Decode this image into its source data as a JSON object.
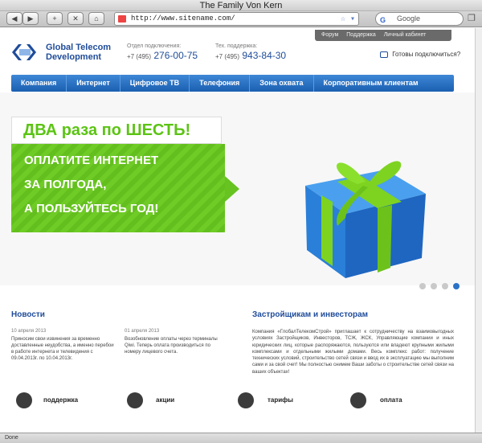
{
  "window": {
    "title": "The Family Von Kern"
  },
  "toolbar": {
    "url": "http://www.sitename.com/",
    "search_placeholder": "Google",
    "search_engine": "G"
  },
  "header": {
    "brand_line1": "Global Telecom",
    "brand_line2": "Development",
    "contacts": [
      {
        "label": "Отдел подключения:",
        "prefix": "+7 (495)",
        "number": "276-00-75"
      },
      {
        "label": "Тех. поддержка:",
        "prefix": "+7 (495)",
        "number": "943-84-30"
      }
    ],
    "top_links": [
      "Форум",
      "Поддержка",
      "Личный кабинет"
    ],
    "ready_text": "Готовы подключиться?"
  },
  "menu": [
    "Компания",
    "Интернет",
    "Цифровое ТВ",
    "Телефония",
    "Зона охвата",
    "Корпоративным клиентам"
  ],
  "banner": {
    "headline": "ДВА раза по ШЕСТЬ!",
    "lines": [
      "ОПЛАТИТЕ ИНТЕРНЕТ",
      "ЗА ПОЛГОДА,",
      "А ПОЛЬЗУЙТЕСЬ ГОД!"
    ]
  },
  "slider": {
    "total": 4,
    "active": 4
  },
  "news": {
    "title": "Новости",
    "items": [
      {
        "date": "10 апреля 2013",
        "text": "Приносим свои извинения за временно доставленные неудобства, а именно перебои в работе интернета и телевидения с 09.04.2013г. по 10.04.2013г."
      },
      {
        "date": "01 апреля 2013",
        "text": "Возобновление оплаты через терминалы Qiwi. Теперь оплата производиться по номеру лицевого счета."
      }
    ]
  },
  "investors": {
    "title": "Застройщикам и инвесторам",
    "text": "Компания «ГлобалТелекомСтрой» приглашает к сотрудничеству на взаимовыгодных условиях Застройщиков, Инвесторов, ТСЖ, ЖСК, Управляющие компании и иных юридических лиц, которые распоряжаются, пользуются или владеют крупными жилыми комплексами и отдельными жилыми домами. Весь комплекс работ: получение технических условий, строительство сетей связи и ввод их в эксплуатацию мы выполним сами и за свой счет! Мы полностью снимем Ваши заботы о строительстве сетей связи на ваших объектах!"
  },
  "footer": [
    "поддержка",
    "акции",
    "тарифы",
    "оплата"
  ],
  "status": "Done",
  "colors": {
    "brand_blue": "#1f4c9a",
    "menu_blue": "#2b72c7",
    "banner_green": "#67c320"
  }
}
